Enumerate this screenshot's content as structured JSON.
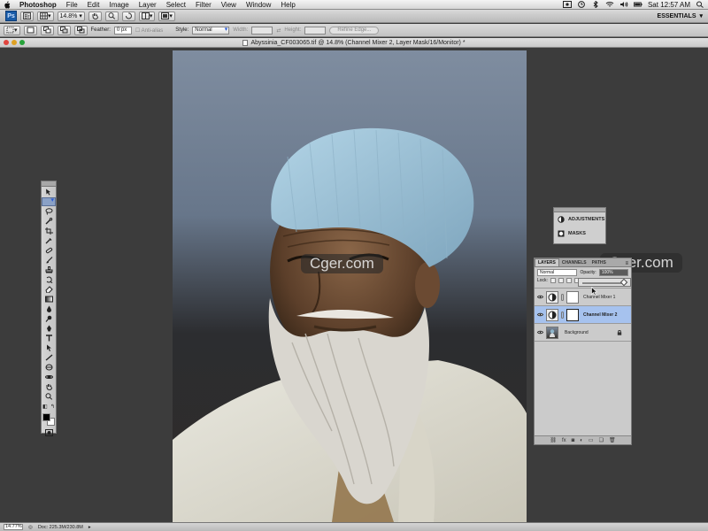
{
  "menubar": {
    "app_name": "Photoshop",
    "items": [
      "File",
      "Edit",
      "Image",
      "Layer",
      "Select",
      "Filter",
      "View",
      "Window",
      "Help"
    ],
    "clock": "Sat 12:57 AM"
  },
  "appbar": {
    "badge": "Ps",
    "zoom": "14.8%",
    "workspace": "ESSENTIALS"
  },
  "options": {
    "feather_label": "Feather:",
    "feather_value": "0 px",
    "antialias_label": "Anti-alias",
    "style_label": "Style:",
    "style_value": "Normal",
    "width_label": "Width:",
    "height_label": "Height:",
    "refine_label": "Refine Edge..."
  },
  "document": {
    "title": "Abyssinia_CF003065.tif @ 14.8% (Channel Mixer 2, Layer Mask/16/Monitor) *"
  },
  "adjustments_panel": {
    "items": [
      "ADJUSTMENTS",
      "MASKS"
    ]
  },
  "layers_panel": {
    "tabs": [
      "LAYERS",
      "CHANNELS",
      "PATHS"
    ],
    "blend_mode": "Normal",
    "opacity_label": "Opacity:",
    "opacity_value": "100%",
    "lock_label": "Lock:",
    "layers": [
      {
        "name": "Channel Mixer 1",
        "selected": false
      },
      {
        "name": "Channel Mixer 2",
        "selected": true
      },
      {
        "name": "Background",
        "selected": false
      }
    ]
  },
  "watermark": "Cger.com",
  "status": {
    "zoom": "14.77%",
    "doc": "Doc: 225.3M/230.8M"
  },
  "colors": {
    "selection": "#a6c2ee",
    "canvas_bg": "#3c3c3c",
    "accent": "#2a5bd7"
  }
}
